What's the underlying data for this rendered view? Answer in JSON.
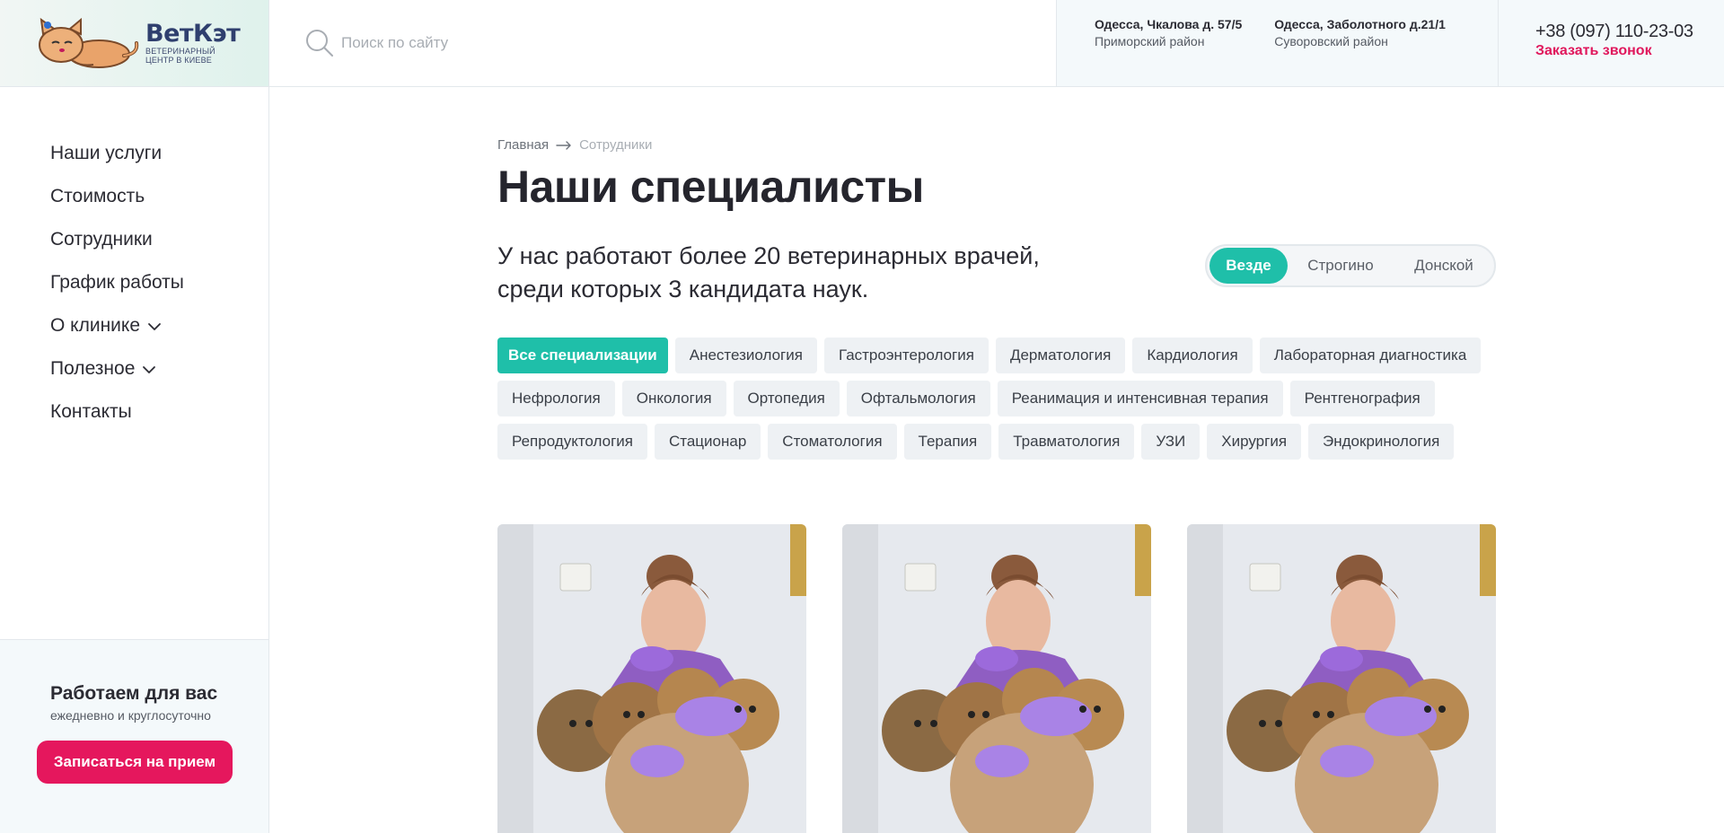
{
  "header": {
    "logo": {
      "title": "ВетКэт",
      "subtitle_line1": "ветеринарный",
      "subtitle_line2": "центр в киеве"
    },
    "search": {
      "placeholder": "Поиск по сайту",
      "value": ""
    },
    "addresses": [
      {
        "street": "Одесса, Чкалова д. 57/5",
        "district": "Приморский район"
      },
      {
        "street": "Одесса, Заболотного д.21/1",
        "district": "Суворовский район"
      }
    ],
    "phone": "+38 (097) 110-23-03",
    "callback_label": "Заказать звонок"
  },
  "sidebar": {
    "items": [
      {
        "label": "Наши услуги",
        "has_dropdown": false
      },
      {
        "label": "Стоимость",
        "has_dropdown": false
      },
      {
        "label": "Сотрудники",
        "has_dropdown": false
      },
      {
        "label": "График работы",
        "has_dropdown": false
      },
      {
        "label": "О клинике",
        "has_dropdown": true
      },
      {
        "label": "Полезное",
        "has_dropdown": true
      },
      {
        "label": "Контакты",
        "has_dropdown": false
      }
    ],
    "bottom": {
      "title": "Работаем для вас",
      "subtitle": "ежедневно и круглосуточно",
      "button_label": "Записаться на прием"
    }
  },
  "main": {
    "breadcrumb": {
      "home": "Главная",
      "current": "Сотрудники"
    },
    "title": "Наши специалисты",
    "lead_line1": "У нас работают более 20 ветеринарных врачей,",
    "lead_line2": "среди которых 3 кандидата наук.",
    "locations": [
      {
        "label": "Везде",
        "active": true
      },
      {
        "label": "Строгино",
        "active": false
      },
      {
        "label": "Донской",
        "active": false
      }
    ],
    "specializations": [
      {
        "label": "Все специализации",
        "active": true
      },
      {
        "label": "Анестезиология",
        "active": false
      },
      {
        "label": "Гастроэнтерология",
        "active": false
      },
      {
        "label": "Дерматология",
        "active": false
      },
      {
        "label": "Кардиология",
        "active": false
      },
      {
        "label": "Лабораторная диагностика",
        "active": false
      },
      {
        "label": "Нефрология",
        "active": false
      },
      {
        "label": "Онкология",
        "active": false
      },
      {
        "label": "Ортопедия",
        "active": false
      },
      {
        "label": "Офтальмология",
        "active": false
      },
      {
        "label": "Реанимация и интенсивная терапия",
        "active": false
      },
      {
        "label": "Рентгенография",
        "active": false
      },
      {
        "label": "Репродуктология",
        "active": false
      },
      {
        "label": "Стационар",
        "active": false
      },
      {
        "label": "Стоматология",
        "active": false
      },
      {
        "label": "Терапия",
        "active": false
      },
      {
        "label": "Травматология",
        "active": false
      },
      {
        "label": "УЗИ",
        "active": false
      },
      {
        "label": "Хирургия",
        "active": false
      },
      {
        "label": "Эндокринология",
        "active": false
      }
    ],
    "specialist_cards": [
      {
        "photo": "veterinarian-with-puppies-photo"
      },
      {
        "photo": "veterinarian-with-puppies-photo"
      },
      {
        "photo": "veterinarian-with-puppies-photo"
      }
    ]
  },
  "colors": {
    "accent_teal": "#1fbfa9",
    "accent_pink": "#e5175d",
    "brand_navy": "#2f3f6e",
    "tag_bg": "#eef1f4",
    "panel_bg": "#f4f9fb"
  },
  "icons": [
    "logo-cat-icon",
    "search-icon",
    "chevron-down-icon",
    "arrow-right-icon"
  ]
}
